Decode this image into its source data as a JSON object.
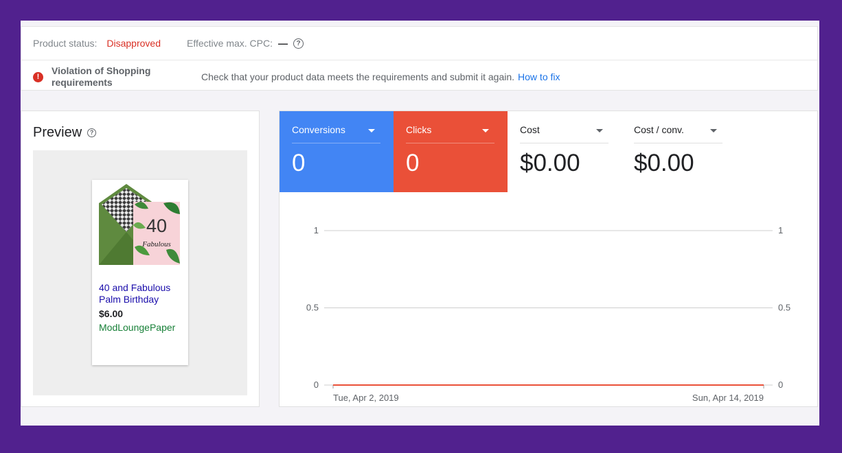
{
  "status": {
    "product_status_label": "Product status:",
    "product_status_value": "Disapproved",
    "cpc_label": "Effective max. CPC:",
    "cpc_value": "—"
  },
  "violation": {
    "title": "Violation of Shopping requirements",
    "message": "Check that your product data meets the requirements and submit it again.",
    "link": "How to fix"
  },
  "preview": {
    "title": "Preview",
    "product": {
      "name": "40 and Fabulous Palm Birthday",
      "price": "$6.00",
      "store": "ModLoungePaper",
      "card_text_big": "40",
      "card_text_script": "Fabulous"
    }
  },
  "metrics": [
    {
      "label": "Conversions",
      "value": "0",
      "color": "#4285f4"
    },
    {
      "label": "Clicks",
      "value": "0",
      "color": "#ea5038"
    },
    {
      "label": "Cost",
      "value": "$0.00",
      "color": "#ffffff"
    },
    {
      "label": "Cost / conv.",
      "value": "$0.00",
      "color": "#ffffff"
    }
  ],
  "chart_data": {
    "type": "line",
    "x": [
      "Tue, Apr 2, 2019",
      "Sun, Apr 14, 2019"
    ],
    "x_tick_labels": [
      "Tue, Apr 2, 2019",
      "Sun, Apr 14, 2019"
    ],
    "y_ticks_left": [
      0,
      0.5,
      1
    ],
    "y_ticks_right": [
      0,
      0.5,
      1
    ],
    "ylim": [
      0,
      1
    ],
    "grid": true,
    "series": [
      {
        "values": [
          0,
          0
        ],
        "color": "#ea5038"
      },
      {
        "values": [
          0,
          0
        ],
        "color": "#4285f4"
      }
    ]
  }
}
